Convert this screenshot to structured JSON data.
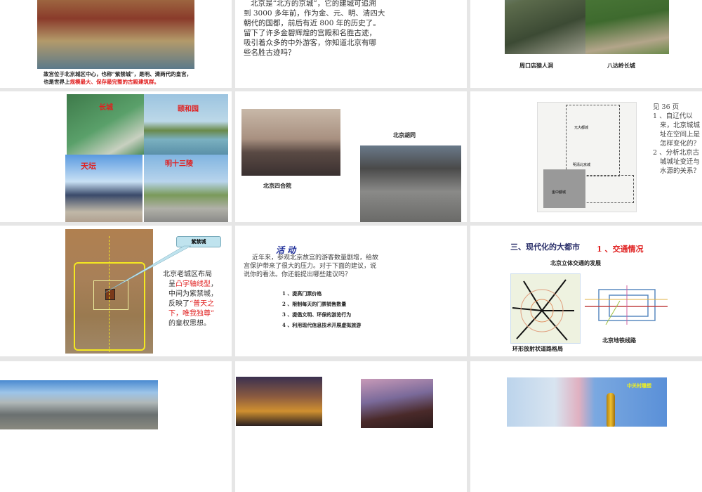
{
  "slides": [
    {
      "caption_black": "故宫位于北京城区中心，也称“紫禁城”，是明、清两代的皇宫，也是世界上",
      "caption_red": "规模最大、保存最完整的古殿建筑群。"
    },
    {
      "lines": [
        "北京是“北方的京城”，它的建城可追溯",
        "到 3000 多年前，作为金、元、明、清四大",
        "朝代的国都，前后有近 800 年的历史了。",
        "留下了许多金碧辉煌的宫殿和名胜古迹，",
        "吸引着众多的中外游客，你知道北京有哪",
        "些名胜古迹吗？"
      ]
    },
    {
      "captions": [
        "周口店猿人洞",
        "八达岭长城"
      ]
    },
    {
      "labels": [
        "长城",
        "颐和园",
        "天坛",
        "明十三陵"
      ]
    },
    {
      "captions": [
        "北京四合院",
        "北京胡同"
      ]
    },
    {
      "map_labels": [
        "元大都城",
        "明清北京城",
        "金中都城"
      ],
      "page_ref": "见 36 页",
      "questions": [
        "1 、自辽代以来，北京城城址在空间上是怎样变化的？",
        "2 、分析北京古城城址变迁与水源的关系？"
      ]
    },
    {
      "callout": "紫禁城",
      "text_lines": [
        {
          "parts": [
            {
              "t": "北京老城区布局",
              "red": false
            }
          ]
        },
        {
          "parts": [
            {
              "t": "呈",
              "red": false
            },
            {
              "t": "凸字轴线型",
              "red": true
            },
            {
              "t": "，",
              "red": false
            }
          ]
        },
        {
          "parts": [
            {
              "t": "中间为紫禁城，",
              "red": false
            }
          ]
        },
        {
          "parts": [
            {
              "t": "反映了",
              "red": false
            },
            {
              "t": "“普天之",
              "red": true
            }
          ]
        },
        {
          "parts": [
            {
              "t": "下，唯我独尊”",
              "red": true
            }
          ]
        },
        {
          "parts": [
            {
              "t": "的皇权思想。",
              "red": false
            }
          ]
        }
      ]
    },
    {
      "title": "活 动",
      "paragraph": [
        "近年来，参观北京故宫的游客数量剧增，给故",
        "宫保护带来了很大的压力。对于下面的建议，说",
        "说你的看法。你还能提出哪些建议吗？"
      ],
      "items": [
        "1 、提高门票价格",
        "2 、限制每天的门票销售数量",
        "3 、提倡文明、环保的游览行为",
        "4 、利用现代信息技术开展虚拟旅游"
      ]
    },
    {
      "title": "三、现代化的大都市",
      "subtitle": "1 、交通情况",
      "heading": "北京立体交通的发展",
      "captions": [
        "环形放射状道路格局",
        "北京地铁线路"
      ]
    },
    {},
    {},
    {
      "label": "中关村雕塑"
    }
  ],
  "colors": {
    "background": "#e6e6e6",
    "accent_red": "#e02020",
    "title_blue": "#1f2f9a"
  }
}
